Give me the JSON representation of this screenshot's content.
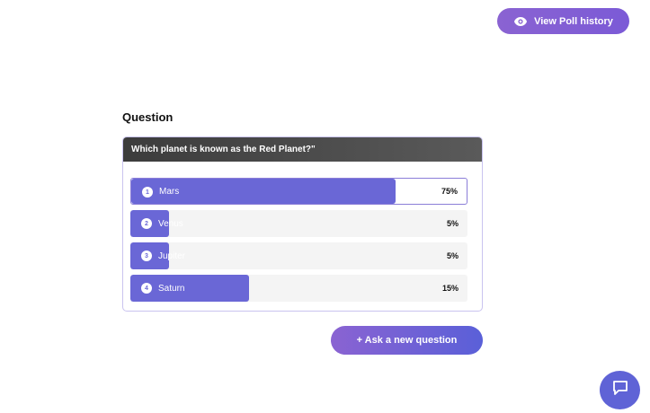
{
  "header": {
    "history_button_label": "View Poll history",
    "history_icon": "eye-icon"
  },
  "poll": {
    "section_title": "Question",
    "question": "Which planet is known as the Red Planet?\"",
    "options": [
      {
        "number": "1",
        "label": "Mars",
        "percent_text": "75%",
        "percent": 75,
        "selected": true
      },
      {
        "number": "2",
        "label": "Venus",
        "percent_text": "5%",
        "percent": 5,
        "selected": false
      },
      {
        "number": "3",
        "label": "Jupiter",
        "percent_text": "5%",
        "percent": 5,
        "selected": false
      },
      {
        "number": "4",
        "label": "Saturn",
        "percent_text": "15%",
        "percent": 15,
        "selected": false
      }
    ]
  },
  "actions": {
    "ask_button_label": "+ Ask a new question"
  },
  "chat": {
    "icon": "chat-icon"
  },
  "colors": {
    "accent": "#6a67d6",
    "button_gradient_start": "#8a63d2",
    "header_dark": "#3c3c3c"
  }
}
